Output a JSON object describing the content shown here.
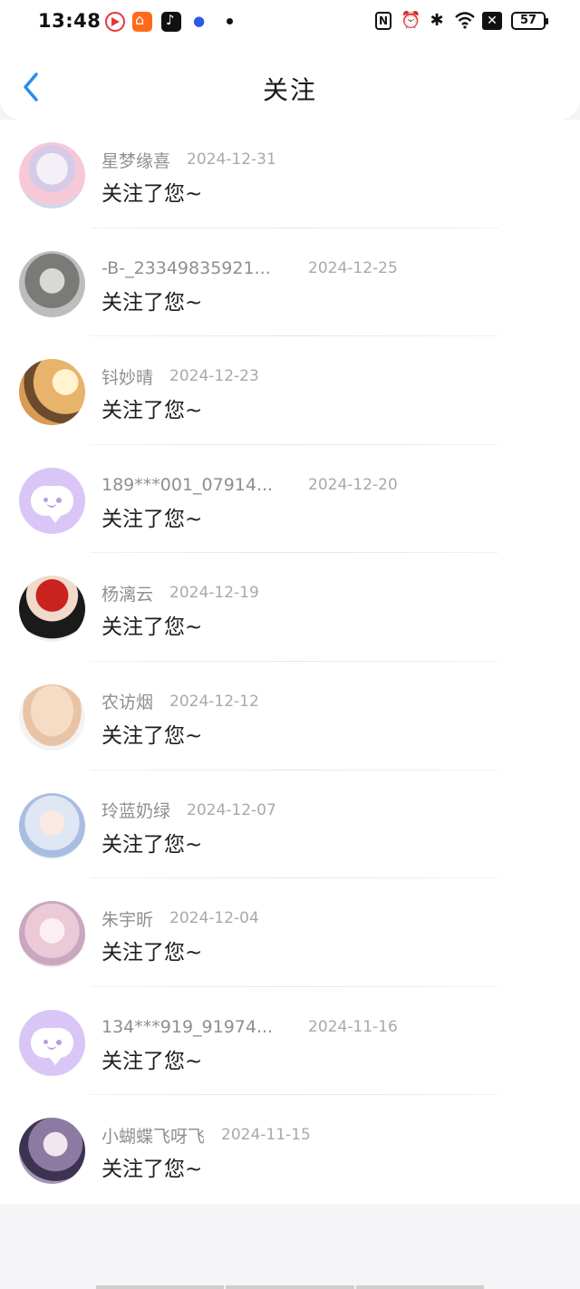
{
  "status_bar": {
    "time": "13:48",
    "app_icons": [
      "video-app-icon",
      "kuaishou-icon",
      "douyin-icon",
      "baidu-icon"
    ],
    "system_icons": [
      "nfc-icon",
      "alarm-icon",
      "bluetooth-icon",
      "wifi-icon",
      "x-box-icon"
    ],
    "battery": "57"
  },
  "header": {
    "title": "关注",
    "back_icon": "chevron-left-icon",
    "accent": "#2a8cf0"
  },
  "notifications": [
    {
      "name": "星梦缘喜",
      "date": "2024-12-31",
      "message": "关注了您~",
      "avatar": "photo"
    },
    {
      "name": "-B-_23349835921...",
      "date": "2024-12-25",
      "message": "关注了您~",
      "avatar": "photo"
    },
    {
      "name": "钭妙晴",
      "date": "2024-12-23",
      "message": "关注了您~",
      "avatar": "photo"
    },
    {
      "name": "189***001_07914...",
      "date": "2024-12-20",
      "message": "关注了您~",
      "avatar": "default"
    },
    {
      "name": "杨漓云",
      "date": "2024-12-19",
      "message": "关注了您~",
      "avatar": "photo"
    },
    {
      "name": "农访烟",
      "date": "2024-12-12",
      "message": "关注了您~",
      "avatar": "photo"
    },
    {
      "name": "玲蓝奶绿",
      "date": "2024-12-07",
      "message": "关注了您~",
      "avatar": "photo"
    },
    {
      "name": "朱宇昕",
      "date": "2024-12-04",
      "message": "关注了您~",
      "avatar": "photo"
    },
    {
      "name": "134***919_91974...",
      "date": "2024-11-16",
      "message": "关注了您~",
      "avatar": "default"
    },
    {
      "name": "小蝴蝶飞呀飞",
      "date": "2024-11-15",
      "message": "关注了您~",
      "avatar": "photo"
    }
  ]
}
